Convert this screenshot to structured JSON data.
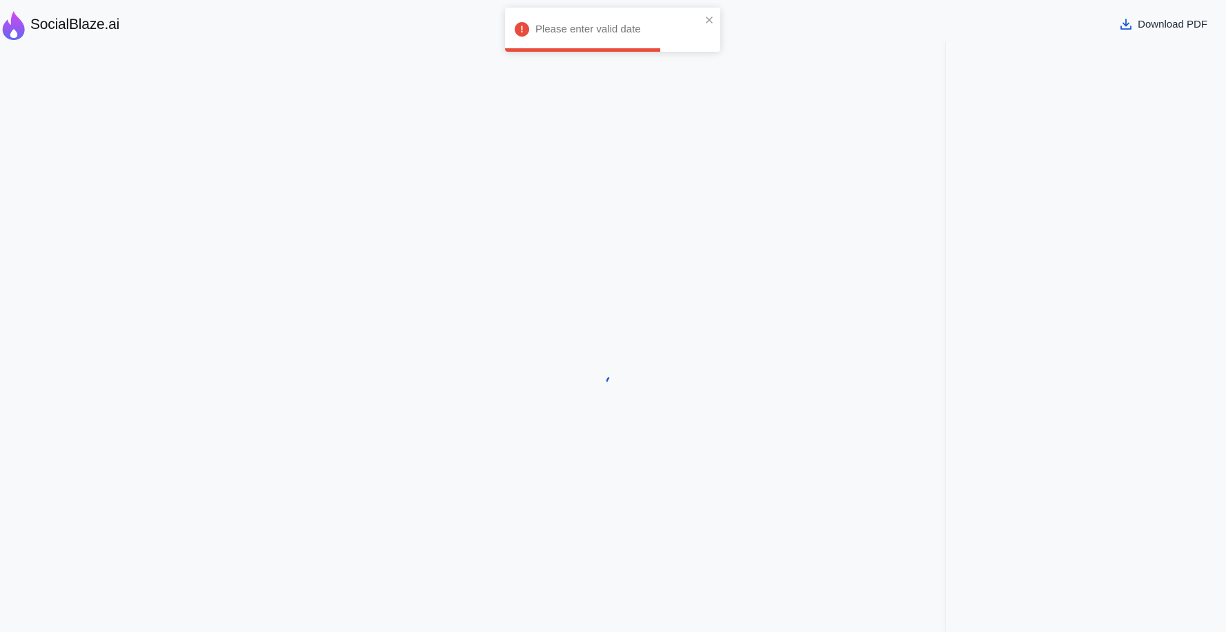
{
  "header": {
    "brand_name": "SocialBlaze.ai",
    "logo_icon": "flame-icon",
    "download_label": "Download PDF",
    "download_icon": "download-icon"
  },
  "toast": {
    "type": "error",
    "message": "Please enter valid date",
    "icon": "exclamation-icon",
    "close_icon": "close-icon",
    "progress_remaining": 0.72
  },
  "loader": {
    "icon": "spinner-icon"
  },
  "colors": {
    "background": "#f8f9fb",
    "accent": "#1a56db",
    "error": "#e74c3c",
    "logo_gradient_start": "#d946ef",
    "logo_gradient_end": "#6366f1"
  }
}
